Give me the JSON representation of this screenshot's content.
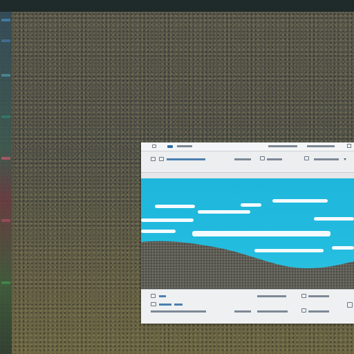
{
  "colors": {
    "sky": "#22bcdf",
    "cloud": "#f4fbfe",
    "window_bg": "#e4e6e8",
    "accent": "#2c6da8"
  },
  "icons": [
    "window-icon",
    "pencil-icon",
    "folder-icon",
    "image-icon",
    "gear-icon",
    "dropdown-icon"
  ]
}
